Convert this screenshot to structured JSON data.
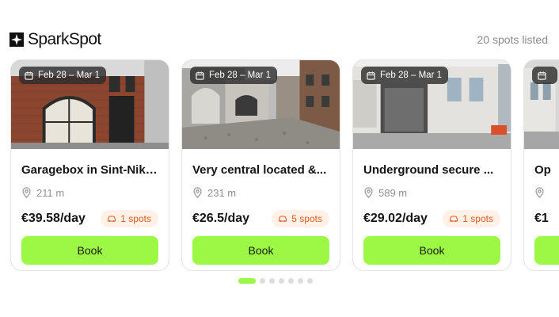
{
  "header": {
    "brand_name": "SparkSpot",
    "brand_icon": "sparkspot-logo-icon",
    "spots_listed": "20 spots listed"
  },
  "cards": [
    {
      "date_range": "Feb 28 – Mar 1",
      "title": "Garagebox in Sint-Nikl...",
      "distance": "211 m",
      "price": "€39.58/day",
      "spots": "1 spots",
      "book_label": "Book"
    },
    {
      "date_range": "Feb 28 – Mar 1",
      "title": "Very central located &...",
      "distance": "231 m",
      "price": "€26.5/day",
      "spots": "5 spots",
      "book_label": "Book"
    },
    {
      "date_range": "Feb 28 – Mar 1",
      "title": "Underground secure ...",
      "distance": "589 m",
      "price": "€29.02/day",
      "spots": "1 spots",
      "book_label": "Book"
    },
    {
      "date_range": "",
      "title": "Op",
      "distance": "",
      "price": "€1",
      "spots": "",
      "book_label": ""
    }
  ],
  "pagination": {
    "total": 7,
    "active_index": 0
  },
  "colors": {
    "accent": "#9cf845",
    "badge_text": "#e05a1c",
    "badge_bg": "#fff1e8",
    "muted": "#8a8a8a"
  },
  "icons": {
    "calendar": "calendar-icon",
    "location": "location-pin-icon",
    "car": "car-icon"
  }
}
